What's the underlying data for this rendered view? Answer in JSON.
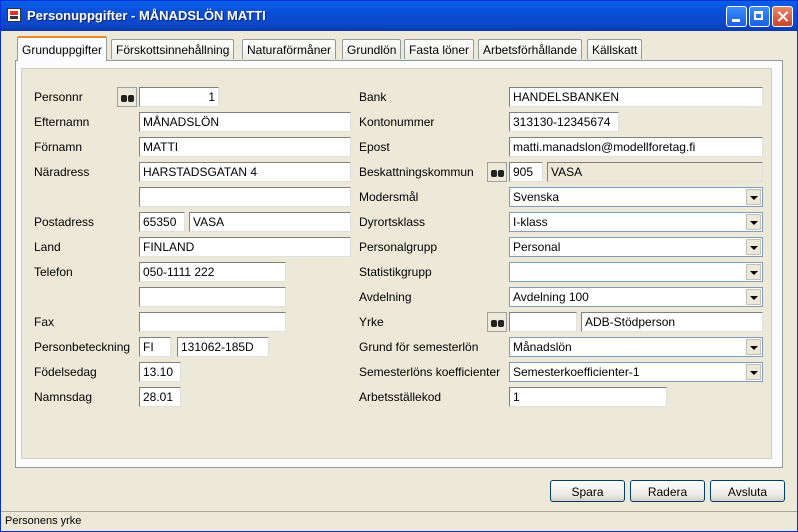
{
  "window": {
    "title": "Personuppgifter - MÅNADSLÖN MATTI"
  },
  "tabs": [
    {
      "label": "Grunduppgifter",
      "active": true
    },
    {
      "label": "Förskottsinnehållning",
      "active": false
    },
    {
      "label": "Naturaförmåner",
      "active": false
    },
    {
      "label": "Grundlön",
      "active": false
    },
    {
      "label": "Fasta löner",
      "active": false
    },
    {
      "label": "Arbetsförhållande",
      "active": false
    },
    {
      "label": "Källskatt",
      "active": false
    }
  ],
  "left": {
    "personnr": {
      "label": "Personnr",
      "value": "1"
    },
    "efternamn": {
      "label": "Efternamn",
      "value": "MÅNADSLÖN"
    },
    "fornamn": {
      "label": "Förnamn",
      "value": "MATTI"
    },
    "naradress": {
      "label": "Näradress",
      "value": "HARSTADSGATAN 4",
      "value2": ""
    },
    "postadress": {
      "label": "Postadress",
      "code": "65350",
      "city": "VASA"
    },
    "land": {
      "label": "Land",
      "value": "FINLAND"
    },
    "telefon": {
      "label": "Telefon",
      "value": "050-1111 222",
      "value2": ""
    },
    "fax": {
      "label": "Fax",
      "value": ""
    },
    "personbeteckning": {
      "label": "Personbeteckning",
      "country": "FI",
      "value": "131062-185D"
    },
    "fodelsedag": {
      "label": "Födelsedag",
      "value": "13.10"
    },
    "namnsdag": {
      "label": "Namnsdag",
      "value": "28.01"
    }
  },
  "right": {
    "bank": {
      "label": "Bank",
      "value": "HANDELSBANKEN"
    },
    "kontonummer": {
      "label": "Kontonummer",
      "value": "313130-12345674"
    },
    "epost": {
      "label": "Epost",
      "value": "matti.manadslon@modellforetag.fi"
    },
    "beskattningskommun": {
      "label": "Beskattningskommun",
      "code": "905",
      "name": "VASA"
    },
    "modersmal": {
      "label": "Modersmål",
      "value": "Svenska"
    },
    "dyrortsklass": {
      "label": "Dyrortsklass",
      "value": "I-klass"
    },
    "personalgrupp": {
      "label": "Personalgrupp",
      "value": "Personal"
    },
    "statistikgrupp": {
      "label": "Statistikgrupp",
      "value": ""
    },
    "avdelning": {
      "label": "Avdelning",
      "value": "Avdelning 100"
    },
    "yrke": {
      "label": "Yrke",
      "code": "",
      "name": "ADB-Stödperson"
    },
    "grund_semesterlon": {
      "label": "Grund för semesterlön",
      "value": "Månadslön"
    },
    "semesterlon_koeff": {
      "label": "Semesterlöns koefficienter",
      "value": "Semesterkoefficienter-1"
    },
    "arbetsstallekod": {
      "label": "Arbetsställekod",
      "value": "1"
    }
  },
  "buttons": {
    "spara": "Spara",
    "radera": "Radera",
    "avsluta": "Avsluta"
  },
  "status": {
    "text": "Personens yrke"
  }
}
